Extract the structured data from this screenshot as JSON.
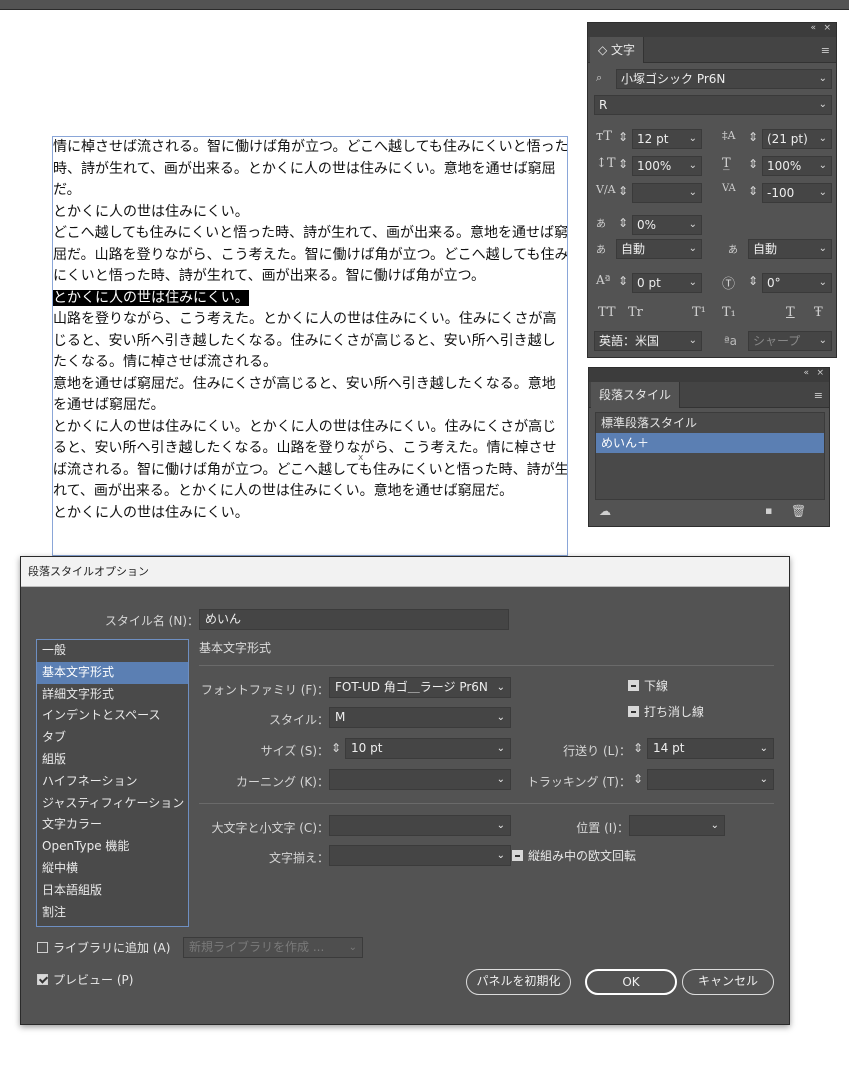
{
  "document": {
    "paragraphs": [
      "情に棹させば流される。智に働けば角が立つ。どこへ越しても住みにくいと悟った時、詩が生れて、画が出来る。とかくに人の世は住みにくい。意地を通せば窮屈だ。",
      "とかくに人の世は住みにくい。",
      "どこへ越しても住みにくいと悟った時、詩が生れて、画が出来る。意地を通せば窮屈だ。山路を登りながら、こう考えた。智に働けば角が立つ。どこへ越しても住みにくいと悟った時、詩が生れて、画が出来る。智に働けば角が立つ。",
      "とかくに人の世は住みにくい。",
      "山路を登りながら、こう考えた。とかくに人の世は住みにくい。住みにくさが高じると、安い所へ引き越したくなる。住みにくさが高じると、安い所へ引き越したくなる。情に棹させば流される。",
      "意地を通せば窮屈だ。住みにくさが高じると、安い所へ引き越したくなる。意地を通せば窮屈だ。",
      "とかくに人の世は住みにくい。とかくに人の世は住みにくい。住みにくさが高じると、安い所へ引き越したくなる。山路を登りながら、こう考えた。情に棹させば流される。智に働けば角が立つ。どこへ越しても住みにくいと悟った時、詩が生れて、画が出来る。とかくに人の世は住みにくい。意地を通せば窮屈だ。",
      "とかくに人の世は住みにくい。"
    ],
    "cursor_mark": "x"
  },
  "char_panel": {
    "collapse_icon": "«",
    "close_icon": "×",
    "tab": "◇ 文字",
    "menu_icon": "≡",
    "font_family": "小塚ゴシック Pr6N",
    "font_style": "R",
    "font_size": "12 pt",
    "leading": "(21 pt)",
    "vertical_scale": "100%",
    "horizontal_scale": "100%",
    "kerning": "",
    "tracking": "-100",
    "tsume": "0%",
    "aki_before": "自動",
    "aki_after": "自動",
    "baseline_shift": "0 pt",
    "rotation": "0°",
    "style_buttons": [
      "TT",
      "Tr",
      "T¹",
      "T₁",
      "T",
      "Ŧ"
    ],
    "language": "英語：米国",
    "antialias_label": "ªa",
    "antialias": "シャープ"
  },
  "para_panel": {
    "collapse_icon": "«",
    "close_icon": "×",
    "tab": "段落スタイル",
    "menu_icon": "≡",
    "styles": [
      "標準段落スタイル",
      "めいん＋"
    ],
    "selected_index": 1
  },
  "dialog": {
    "title": "段落スタイルオプション",
    "style_name_label": "スタイル名 (N)：",
    "style_name": "めいん",
    "categories": [
      "一般",
      "基本文字形式",
      "詳細文字形式",
      "インデントとスペース",
      "タブ",
      "組版",
      "ハイフネーション",
      "ジャスティフィケーション",
      "文字カラー",
      "OpenType 機能",
      "縦中横",
      "日本語組版",
      "割注"
    ],
    "active_category": 1,
    "section_title": "基本文字形式",
    "font_family_label": "フォントファミリ (F)：",
    "font_family": "FOT-UD 角ゴ＿ラージ Pr6N",
    "style_label": "スタイル：",
    "style": "M",
    "size_label": "サイズ (S)：",
    "size": "10 pt",
    "leading_label": "行送り (L)：",
    "leading": "14 pt",
    "kerning_label": "カーニング (K)：",
    "kerning": "",
    "tracking_label": "トラッキング (T)：",
    "tracking": "",
    "underline": "下線",
    "strikethrough": "打ち消し線",
    "case_label": "大文字と小文字 (C)：",
    "case": "",
    "position_label": "位置 (I)：",
    "position": "",
    "align_label": "文字揃え：",
    "align": "",
    "tate_chu_yoko": "縦組み中の欧文回転",
    "add_library": "ライブラリに追加 (A)",
    "library_select": "新規ライブラリを作成 ...",
    "preview": "プレビュー (P)",
    "reset_button": "パネルを初期化",
    "ok_button": "OK",
    "cancel_button": "キャンセル"
  },
  "colors": {
    "accent": "#5b7fb3",
    "panel": "#535353",
    "field": "#454545"
  }
}
